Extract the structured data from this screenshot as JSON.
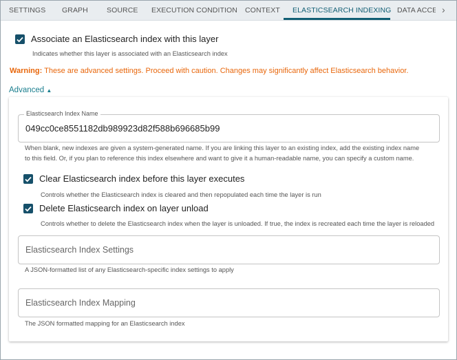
{
  "tabs": [
    "SETTINGS",
    "GRAPH",
    "SOURCE",
    "EXECUTION CONDITION",
    "CONTEXT",
    "ELASTICSEARCH INDEXING",
    "DATA ACCES"
  ],
  "active_tab": "ELASTICSEARCH INDEXING",
  "associate": {
    "label": "Associate an Elasticsearch index with this layer",
    "help": "Indicates whether this layer is associated with an Elasticsearch index",
    "checked": true
  },
  "warning": {
    "prefix": "Warning:",
    "text": "These are advanced settings. Proceed with caution. Changes may significantly affect Elasticsearch behavior."
  },
  "advanced_label": "Advanced",
  "index_name": {
    "label": "Elasticsearch Index Name",
    "value": "049cc0ce8551182db989923d82f588b696685b99",
    "help1": "When blank, new indexes are given a system-generated name. If you are linking this layer to an existing index, add the existing index name",
    "help2": "to this field. Or, if you plan to reference this index elsewhere and want to give it a human-readable name, you can specify a custom name."
  },
  "clear_index": {
    "label": "Clear Elasticsearch index before this layer executes",
    "help": "Controls whether the Elasticsearch index is cleared and then repopulated each time the layer is run",
    "checked": true
  },
  "delete_index": {
    "label": "Delete Elasticsearch index on layer unload",
    "help": "Controls whether to delete the Elasticsearch index when the layer is unloaded. If true, the index is recreated each time the layer is reloaded",
    "checked": true
  },
  "index_settings": {
    "placeholder": "Elasticsearch Index Settings",
    "help": "A JSON-formatted list of any Elasticsearch-specific index settings to apply"
  },
  "index_mapping": {
    "placeholder": "Elasticsearch Index Mapping",
    "help": "The JSON formatted mapping for an Elasticsearch index"
  }
}
